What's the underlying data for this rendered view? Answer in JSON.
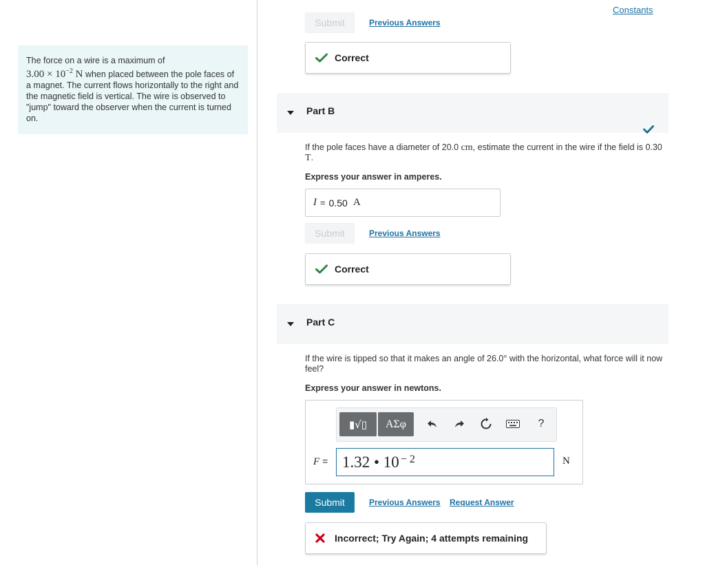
{
  "header": {
    "constants_link": "Constants"
  },
  "intro": {
    "text_before": "The force on a wire is a maximum of",
    "force_value": "3.00 × 10",
    "force_exponent": "−2",
    "force_unit": "N",
    "text_after": "when placed between the pole faces of a magnet. The current flows horizontally to the right and the magnetic field is vertical. The wire is observed to \"jump\" toward the observer when the current is turned on."
  },
  "part_a": {
    "submit_label": "Submit",
    "previous_answers_label": "Previous Answers",
    "feedback": "Correct"
  },
  "part_b": {
    "title": "Part B",
    "question_before": "If the pole faces have a diameter of",
    "diameter": "20.0",
    "diameter_unit": "cm",
    "question_mid": ", estimate the current in the wire if the field is",
    "field": "0.30",
    "field_unit": "T",
    "question_end": ".",
    "instruction": "Express your answer in amperes.",
    "answer_var": "I",
    "answer_eq": "=",
    "answer_value": "0.50",
    "answer_unit": "A",
    "submit_label": "Submit",
    "previous_answers_label": "Previous Answers",
    "feedback": "Correct"
  },
  "part_c": {
    "title": "Part C",
    "question_before": "If the wire is tipped so that it makes an angle of",
    "angle": "26.0°",
    "question_after": "with the horizontal, what force will it now feel?",
    "instruction": "Express your answer in newtons.",
    "toolbar": {
      "templates_button": "▮√▯",
      "symbols_button": "ΑΣφ",
      "undo_icon": "undo-icon",
      "redo_icon": "redo-icon",
      "reset_icon": "reset-icon",
      "keyboard_icon": "keyboard-icon",
      "help_label": "?"
    },
    "answer_var": "F",
    "answer_eq": "=",
    "answer_mantissa": "1.32 • 10",
    "answer_exponent": "− 2",
    "answer_unit": "N",
    "submit_label": "Submit",
    "previous_answers_label": "Previous Answers",
    "request_answer_label": "Request Answer",
    "feedback": "Incorrect; Try Again; 4 attempts remaining"
  },
  "colors": {
    "accent": "#1a7aa1",
    "link": "#1f72a3",
    "correct_green": "#2e8540",
    "incorrect_red": "#d0021b",
    "intro_bg": "#eaf6f7"
  }
}
